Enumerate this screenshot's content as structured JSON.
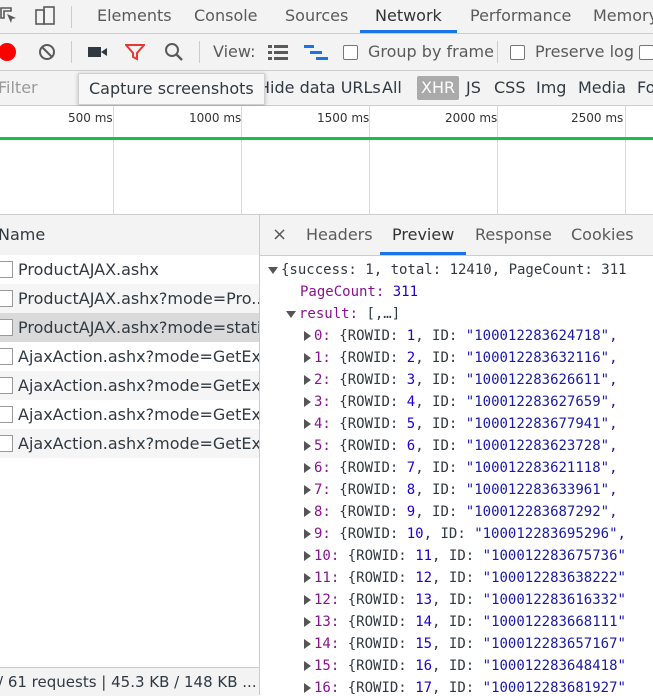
{
  "top_tabs": {
    "elements": "Elements",
    "console": "Console",
    "sources": "Sources",
    "network": "Network",
    "performance": "Performance",
    "memory": "Memory"
  },
  "toolbar": {
    "view_label": "View:",
    "group_by_frame": "Group by frame",
    "preserve_log": "Preserve log"
  },
  "filter": {
    "placeholder": "Filter",
    "tooltip": "Capture screenshots",
    "hide_data_urls": "Hide data URLs",
    "types": [
      "All",
      "XHR",
      "JS",
      "CSS",
      "Img",
      "Media",
      "Fo"
    ]
  },
  "timeline": {
    "ticks": [
      "500 ms",
      "1000 ms",
      "1500 ms",
      "2000 ms",
      "2500 ms"
    ]
  },
  "requests": {
    "column_name": "Name",
    "rows": [
      "ProductAJAX.ashx",
      "ProductAJAX.ashx?mode=Pro...",
      "ProductAJAX.ashx?mode=stati...",
      "AjaxAction.ashx?mode=GetEx...",
      "AjaxAction.ashx?mode=GetEx...",
      "AjaxAction.ashx?mode=GetEx...",
      "AjaxAction.ashx?mode=GetEx..."
    ],
    "status": "/ 61 requests  |  45.3 KB / 148 KB ..."
  },
  "detail_tabs": {
    "close": "×",
    "headers": "Headers",
    "preview": "Preview",
    "response": "Response",
    "cookies": "Cookies"
  },
  "preview": {
    "root_line": "{success: 1, total: 12410, PageCount: 311",
    "pagecount_key": "PageCount:",
    "pagecount_value": "311",
    "result_key": "result:",
    "result_value": "[,…]",
    "items": [
      {
        "index": "0:",
        "rowid": "1",
        "id": "\"100012283624718\","
      },
      {
        "index": "1:",
        "rowid": "2",
        "id": "\"100012283632116\","
      },
      {
        "index": "2:",
        "rowid": "3",
        "id": "\"100012283626611\","
      },
      {
        "index": "3:",
        "rowid": "4",
        "id": "\"100012283627659\","
      },
      {
        "index": "4:",
        "rowid": "5",
        "id": "\"100012283677941\","
      },
      {
        "index": "5:",
        "rowid": "6",
        "id": "\"100012283623728\","
      },
      {
        "index": "6:",
        "rowid": "7",
        "id": "\"100012283621118\","
      },
      {
        "index": "7:",
        "rowid": "8",
        "id": "\"100012283633961\","
      },
      {
        "index": "8:",
        "rowid": "9",
        "id": "\"100012283687292\","
      },
      {
        "index": "9:",
        "rowid": "10",
        "id": "\"100012283695296\","
      },
      {
        "index": "10:",
        "rowid": "11",
        "id": "\"100012283675736\""
      },
      {
        "index": "11:",
        "rowid": "12",
        "id": "\"100012283638222\""
      },
      {
        "index": "12:",
        "rowid": "13",
        "id": "\"100012283616332\""
      },
      {
        "index": "13:",
        "rowid": "14",
        "id": "\"100012283668111\""
      },
      {
        "index": "14:",
        "rowid": "15",
        "id": "\"100012283657167\""
      },
      {
        "index": "15:",
        "rowid": "16",
        "id": "\"100012283648418\""
      },
      {
        "index": "16:",
        "rowid": "17",
        "id": "\"100012283681927\""
      }
    ],
    "rowid_label": "{ROWID:",
    "id_label": "ID:"
  },
  "colors": {
    "accent": "#1a73e8",
    "record": "#ff0000",
    "filter_icon": "#e53935",
    "timeline_green": "#14c14a"
  }
}
